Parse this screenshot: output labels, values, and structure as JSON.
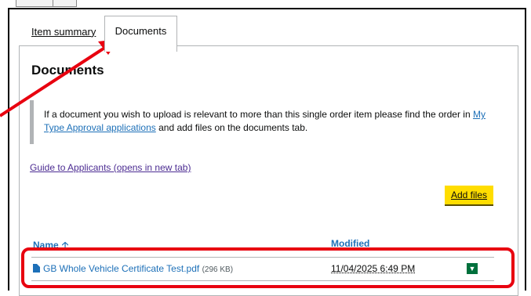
{
  "tabs": [
    {
      "label": "Item summary"
    },
    {
      "label": "Documents"
    }
  ],
  "heading": "Documents",
  "inset": {
    "text_before": "If a document you wish to upload is relevant to more than this single order item please find the order in ",
    "link": "My Type Approval applications",
    "text_after": " and add files on the documents tab."
  },
  "guide_link": "Guide to Applicants (opens in new tab)",
  "add_files": "Add files",
  "table": {
    "headers": [
      "Name",
      "Modified"
    ],
    "rows": [
      {
        "name": "GB Whole Vehicle Certificate Test.pdf",
        "size": "(296 KB)",
        "modified": "11/04/2025 6:49 PM"
      }
    ]
  },
  "colors": {
    "annotation": "#e8000f",
    "accent": "#1d70b8",
    "button": "#ffdd00"
  },
  "icons": {
    "file": "file-icon",
    "sort": "sort-up-arrow-icon",
    "download": "chevron-down-icon"
  }
}
